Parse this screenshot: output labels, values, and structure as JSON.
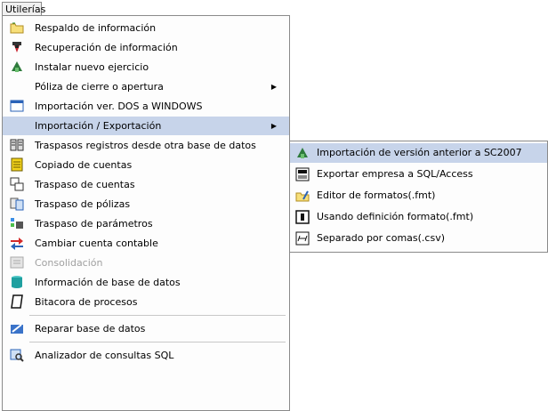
{
  "menubar": {
    "menu_label": "Utilerías"
  },
  "menu": {
    "items": [
      {
        "label": "Respaldo de información",
        "icon": "folder-backup-icon"
      },
      {
        "label": "Recuperación de información",
        "icon": "restore-icon"
      },
      {
        "label": "Instalar nuevo ejercicio",
        "icon": "new-fiscal-year-icon"
      },
      {
        "label": "Póliza de cierre o apertura",
        "has_submenu": true
      },
      {
        "label": "Importación ver. DOS a WINDOWS",
        "icon": "window-icon"
      },
      {
        "label": "Importación / Exportación",
        "has_submenu": true,
        "highlighted": true
      },
      {
        "label": "Traspasos registros desde otra base de datos",
        "icon": "transfer-records-icon"
      },
      {
        "label": "Copiado de cuentas",
        "icon": "copy-accounts-icon"
      },
      {
        "label": "Traspaso de cuentas",
        "icon": "transfer-accounts-icon"
      },
      {
        "label": "Traspaso de pólizas",
        "icon": "transfer-policies-icon"
      },
      {
        "label": "Traspaso de parámetros",
        "icon": "transfer-parameters-icon"
      },
      {
        "label": "Cambiar cuenta contable",
        "icon": "change-account-icon"
      },
      {
        "label": "Consolidación",
        "icon": "consolidation-icon",
        "disabled": true
      },
      {
        "label": "Información de base de datos",
        "icon": "database-icon"
      },
      {
        "label": "Bitacora de procesos",
        "icon": "process-log-icon"
      },
      {
        "label": "Reparar base de datos",
        "icon": "repair-database-icon"
      },
      {
        "label": "Analizador de consultas SQL",
        "icon": "sql-analyzer-icon"
      }
    ]
  },
  "submenu": {
    "items": [
      {
        "label": "Importación de versión anterior a SC2007",
        "icon": "import-previous-version-icon",
        "highlighted": true
      },
      {
        "label": "Exportar empresa a SQL/Access",
        "icon": "export-company-icon"
      },
      {
        "label": "Editor de formatos(.fmt)",
        "icon": "format-editor-icon"
      },
      {
        "label": "Usando definición formato(.fmt)",
        "icon": "format-definition-icon"
      },
      {
        "label": "Separado por comas(.csv)",
        "icon": "csv-icon"
      }
    ]
  },
  "colors": {
    "highlight": "#c7d4ea",
    "disabled_text": "#a0a0a0",
    "border": "#8a8a8a"
  }
}
